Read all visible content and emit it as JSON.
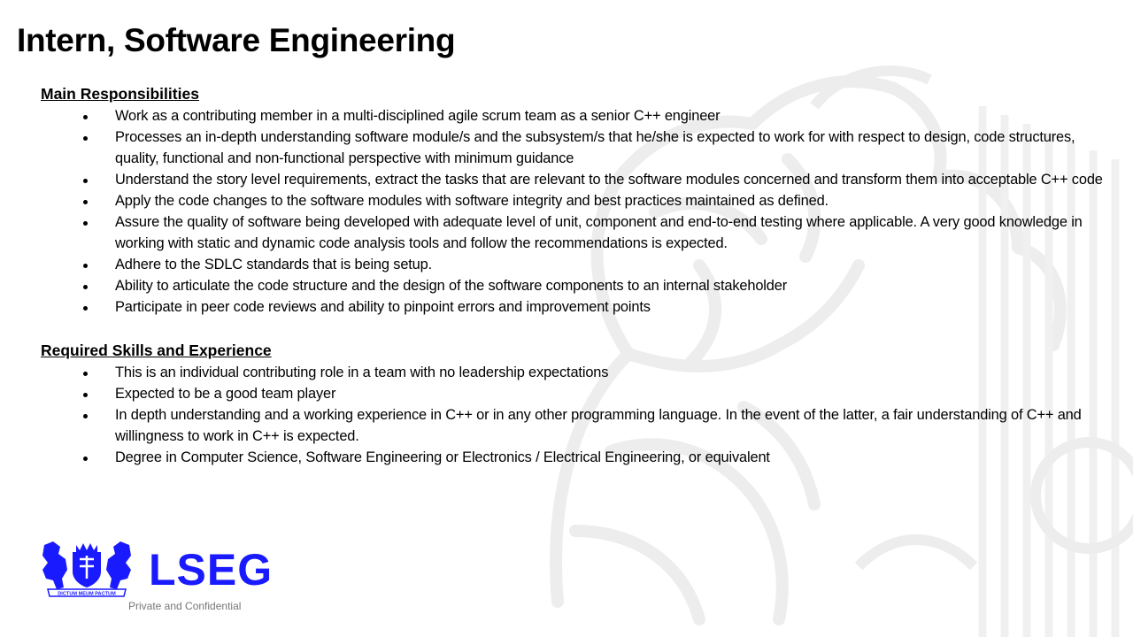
{
  "slide": {
    "title": "Intern, Software Engineering"
  },
  "sections": [
    {
      "heading": "Main Responsibilities",
      "items": [
        "Work as a contributing member in a multi-disciplined agile scrum team as a senior C++ engineer",
        "Processes an in-depth understanding software module/s and the subsystem/s that he/she is expected to work for with respect to design, code structures, quality, functional and non-functional perspective with minimum guidance",
        "Understand the story level requirements, extract the tasks that are relevant to the software modules concerned and transform them into acceptable C++ code",
        "Apply the code changes to the software modules with software integrity and best practices maintained as defined.",
        "Assure the quality of software being developed with adequate level of unit, component and end-to-end testing where applicable. A very good knowledge in working with static and dynamic code analysis tools and follow the recommendations is expected.",
        "Adhere to the SDLC standards that is being setup.",
        "Ability to articulate the code structure and the design of the software components to an internal stakeholder",
        "Participate in peer code reviews and ability to pinpoint errors and improvement points"
      ]
    },
    {
      "heading": "Required Skills and Experience",
      "items": [
        "This is an individual contributing role in a team with no leadership expectations",
        "Expected to be a good team player",
        "In depth understanding and a working experience in C++ or in any other programming language. In the event of the latter, a fair understanding of C++ and willingness to work in C++ is expected.",
        "Degree in Computer Science, Software Engineering or Electronics / Electrical Engineering, or equivalent"
      ]
    }
  ],
  "footer": {
    "logo_text": "LSEG",
    "note": "Private and Confidential",
    "crest_motto": "DICTUM MEUM PACTUM"
  },
  "colors": {
    "brand_blue": "#1a1aff",
    "watermark": "#f0f0f0",
    "footer_text": "#777777"
  },
  "icons": {
    "logo": "lseg-crest-icon",
    "watermark": "griffin-watermark-icon",
    "bullet": "bullet-dot-icon"
  }
}
